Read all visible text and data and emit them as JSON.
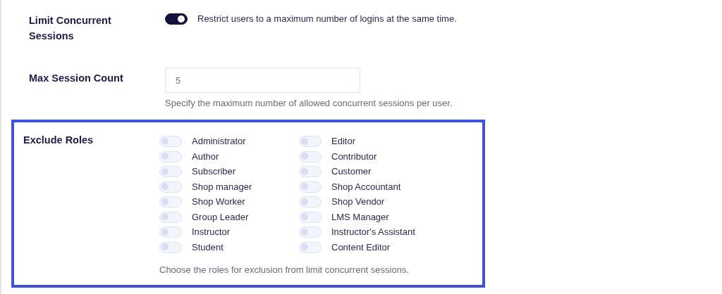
{
  "limit_concurrent_sessions": {
    "label": "Limit Concurrent Sessions",
    "on": true,
    "description": "Restrict users to a maximum number of logins at the same time."
  },
  "max_session_count": {
    "label": "Max Session Count",
    "value": "5",
    "help": "Specify the maximum number of allowed concurrent sessions per user."
  },
  "exclude_roles": {
    "label": "Exclude Roles",
    "highlighted": true,
    "help": "Choose the roles for exclusion from limit concurrent sessions.",
    "roles": [
      {
        "label": "Administrator",
        "on": false
      },
      {
        "label": "Editor",
        "on": false
      },
      {
        "label": "Author",
        "on": false
      },
      {
        "label": "Contributor",
        "on": false
      },
      {
        "label": "Subscriber",
        "on": false
      },
      {
        "label": "Customer",
        "on": false
      },
      {
        "label": "Shop manager",
        "on": false
      },
      {
        "label": "Shop Accountant",
        "on": false
      },
      {
        "label": "Shop Worker",
        "on": false
      },
      {
        "label": "Shop Vendor",
        "on": false
      },
      {
        "label": "Group Leader",
        "on": false
      },
      {
        "label": "LMS Manager",
        "on": false
      },
      {
        "label": "Instructor",
        "on": false
      },
      {
        "label": "Instructor's Assistant",
        "on": false
      },
      {
        "label": "Student",
        "on": false
      },
      {
        "label": "Content Editor",
        "on": false
      }
    ]
  }
}
